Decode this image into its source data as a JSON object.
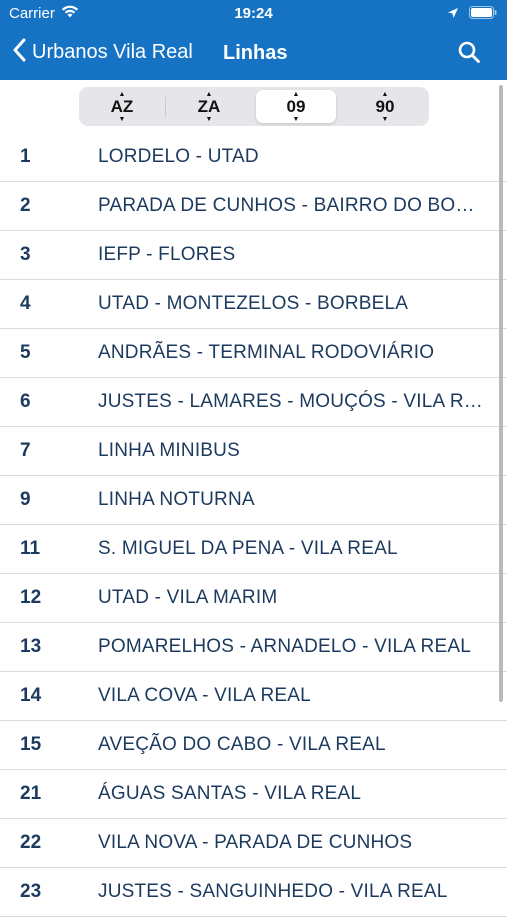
{
  "status_bar": {
    "carrier": "Carrier",
    "time": "19:24"
  },
  "nav": {
    "back_label": "Urbanos Vila Real",
    "title": "Linhas"
  },
  "sort_options": [
    {
      "id": "az",
      "label": "AZ",
      "active": false
    },
    {
      "id": "za",
      "label": "ZA",
      "active": false
    },
    {
      "id": "09",
      "label": "09",
      "active": true
    },
    {
      "id": "90",
      "label": "90",
      "active": false
    }
  ],
  "lines": [
    {
      "number": "1",
      "name": "LORDELO - UTAD"
    },
    {
      "number": "2",
      "name": "PARADA DE CUNHOS - BAIRRO DO BOSQUE"
    },
    {
      "number": "3",
      "name": "IEFP - FLORES"
    },
    {
      "number": "4",
      "name": "UTAD - MONTEZELOS - BORBELA"
    },
    {
      "number": "5",
      "name": "ANDRÃES - TERMINAL RODOVIÁRIO"
    },
    {
      "number": "6",
      "name": "JUSTES - LAMARES - MOUÇÓS - VILA REAL"
    },
    {
      "number": "7",
      "name": "LINHA MINIBUS"
    },
    {
      "number": "9",
      "name": "LINHA NOTURNA"
    },
    {
      "number": "11",
      "name": "S. MIGUEL DA PENA - VILA REAL"
    },
    {
      "number": "12",
      "name": "UTAD - VILA MARIM"
    },
    {
      "number": "13",
      "name": "POMARELHOS - ARNADELO - VILA REAL"
    },
    {
      "number": "14",
      "name": "VILA COVA - VILA REAL"
    },
    {
      "number": "15",
      "name": "AVEÇÃO DO CABO - VILA REAL"
    },
    {
      "number": "21",
      "name": "ÁGUAS SANTAS - VILA REAL"
    },
    {
      "number": "22",
      "name": "VILA NOVA - PARADA DE CUNHOS"
    },
    {
      "number": "23",
      "name": "JUSTES - SANGUINHEDO - VILA REAL"
    }
  ],
  "colors": {
    "header": "#1673c4",
    "text": "#1c3a5e",
    "separator": "#dcdce0"
  }
}
